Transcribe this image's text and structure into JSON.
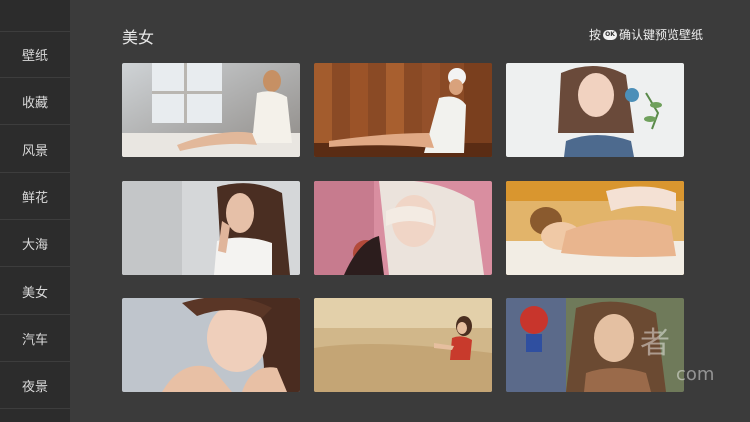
{
  "sidebar": {
    "items": [
      {
        "label": "壁纸"
      },
      {
        "label": "收藏"
      },
      {
        "label": "风景"
      },
      {
        "label": "鲜花"
      },
      {
        "label": "大海"
      },
      {
        "label": "美女"
      },
      {
        "label": "汽车"
      },
      {
        "label": "夜景"
      }
    ]
  },
  "header": {
    "title": "美女",
    "hint_prefix": "按",
    "ok_label": "OK",
    "hint_suffix": "确认键预览壁纸"
  },
  "gallery": {
    "tiles": [
      {
        "name": "woman-at-window",
        "icon": "photo-thumbnail"
      },
      {
        "name": "woman-in-towel-wood",
        "icon": "photo-thumbnail"
      },
      {
        "name": "woman-with-flowers",
        "icon": "photo-thumbnail"
      },
      {
        "name": "woman-brunette-white",
        "icon": "photo-thumbnail"
      },
      {
        "name": "woman-blonde-pink",
        "icon": "photo-thumbnail"
      },
      {
        "name": "woman-massage",
        "icon": "photo-thumbnail"
      },
      {
        "name": "woman-portrait-hands",
        "icon": "photo-thumbnail"
      },
      {
        "name": "woman-in-field",
        "icon": "photo-thumbnail"
      },
      {
        "name": "woman-spiderman",
        "icon": "photo-thumbnail"
      }
    ]
  },
  "watermark": {
    "big": "者",
    "small": "com"
  },
  "colors": {
    "background": "#3b3b3b",
    "sidebar": "#2c2c2c",
    "text": "#e6e6e6"
  }
}
